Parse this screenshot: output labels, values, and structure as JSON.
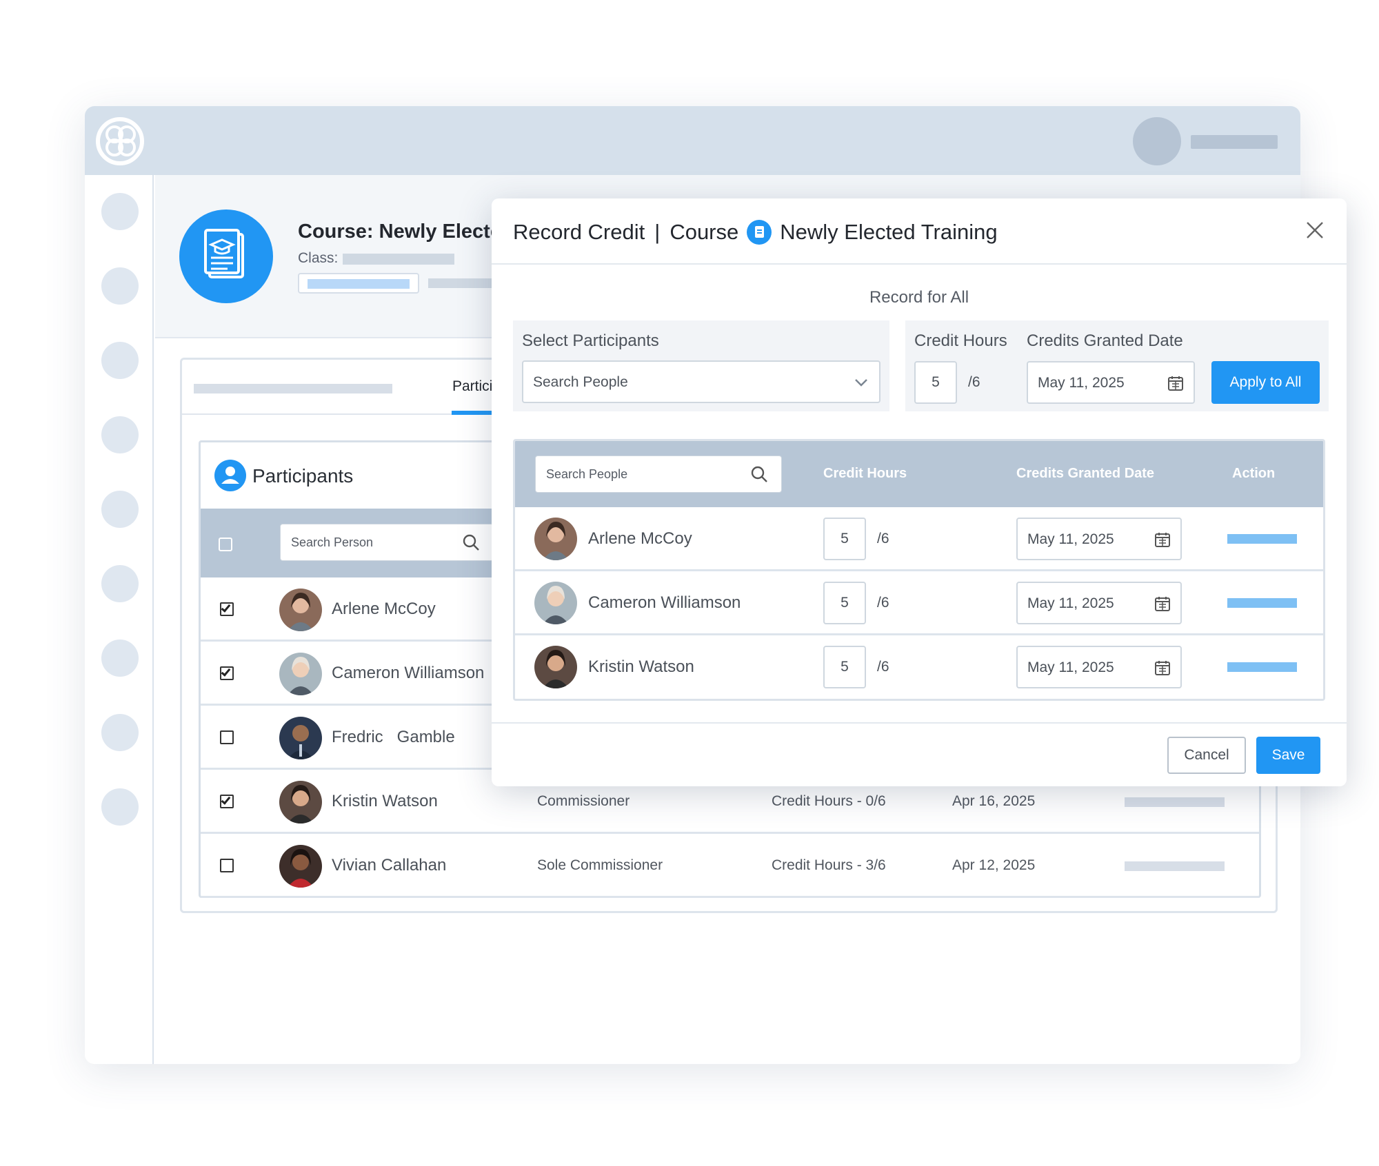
{
  "course": {
    "title": "Course: Newly Elected",
    "class_label": "Class:"
  },
  "tabs": {
    "active_label": "Partici"
  },
  "participants": {
    "title": "Participants",
    "search_placeholder": "Search Person",
    "rows": [
      {
        "name": "Arlene McCoy",
        "checked": true,
        "role": "",
        "hours": "",
        "date": ""
      },
      {
        "name": "Cameron Williamson",
        "checked": true,
        "role": "",
        "hours": "",
        "date": ""
      },
      {
        "name": "Fredric   Gamble",
        "checked": false,
        "role": "",
        "hours": "",
        "date": ""
      },
      {
        "name": "Kristin Watson",
        "checked": true,
        "role": "Commissioner",
        "hours": "Credit Hours - 0/6",
        "date": "Apr 16, 2025"
      },
      {
        "name": "Vivian Callahan",
        "checked": false,
        "role": "Sole Commissioner",
        "hours": "Credit Hours - 3/6",
        "date": "Apr 12, 2025"
      }
    ]
  },
  "modal": {
    "title_part1": "Record Credit",
    "separator": "|",
    "title_part2": "Course",
    "course_name": "Newly Elected Training",
    "record_for_all": "Record for All",
    "select_participants_label": "Select Participants",
    "select_placeholder": "Search People",
    "credit_hours_label": "Credit Hours",
    "credits_granted_date_label": "Credits Granted Date",
    "credit_hours_value": "5",
    "credit_hours_total": "/6",
    "date_value": "May 11, 2025",
    "apply_label": "Apply to All",
    "table": {
      "search_placeholder": "Search People",
      "col_hours": "Credit Hours",
      "col_date": "Credits Granted Date",
      "col_action": "Action",
      "rows": [
        {
          "name": "Arlene McCoy",
          "hours": "5",
          "total": "/6",
          "date": "May 11, 2025"
        },
        {
          "name": "Cameron Williamson",
          "hours": "5",
          "total": "/6",
          "date": "May 11, 2025"
        },
        {
          "name": "Kristin Watson",
          "hours": "5",
          "total": "/6",
          "date": "May 11, 2025"
        }
      ]
    },
    "cancel_label": "Cancel",
    "save_label": "Save"
  },
  "colors": {
    "accent": "#2196f3",
    "header_bg": "#d5e0eb",
    "table_head": "#b7c6d6"
  }
}
